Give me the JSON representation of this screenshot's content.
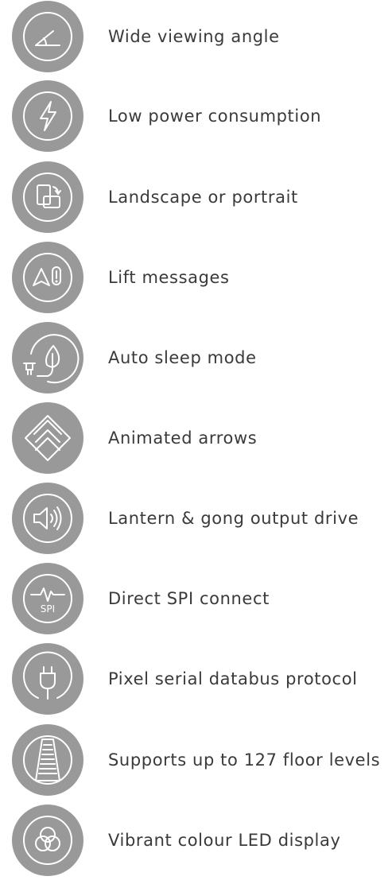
{
  "features": [
    {
      "label": "Wide viewing angle",
      "icon": "viewing-angle-icon"
    },
    {
      "label": "Low power consumption",
      "icon": "lightning-bolt-icon"
    },
    {
      "label": "Landscape or portrait",
      "icon": "rotate-orientation-icon"
    },
    {
      "label": "Lift messages",
      "icon": "warning-message-icon"
    },
    {
      "label": "Auto sleep mode",
      "icon": "plug-leaf-icon"
    },
    {
      "label": "Animated arrows",
      "icon": "chevron-arrows-icon"
    },
    {
      "label": "Lantern & gong output drive",
      "icon": "speaker-icon"
    },
    {
      "label": "Direct SPI connect",
      "icon": "spi-pulse-icon",
      "icon_text": "SPI"
    },
    {
      "label": "Pixel serial databus protocol",
      "icon": "power-plug-icon"
    },
    {
      "label": "Supports up to 127 floor levels",
      "icon": "floor-levels-icon"
    },
    {
      "label": "Vibrant colour LED display",
      "icon": "colour-circles-icon"
    }
  ],
  "colors": {
    "badge": "#999999",
    "icon": "#ffffff",
    "text": "#3a3a3a",
    "background": "#ffffff"
  }
}
